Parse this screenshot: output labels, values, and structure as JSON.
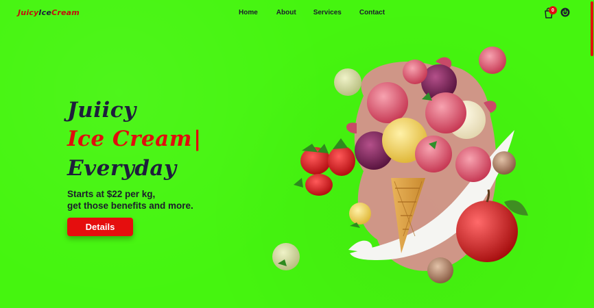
{
  "brand": {
    "part1": "Juicy",
    "part2": "Ice",
    "part3": "Cream"
  },
  "nav": {
    "items": [
      "Home",
      "About",
      "Services",
      "Contact"
    ]
  },
  "cart": {
    "count": "0",
    "icon": "shopping-bag-icon"
  },
  "power": {
    "icon": "power-icon"
  },
  "hero": {
    "line1": "Juiicy",
    "line2": "Ice Cream",
    "caret": "|",
    "line3": "Everyday",
    "sub1": "Starts at $22 per kg,",
    "sub2": "get those benefits and more.",
    "button": "Details"
  },
  "colors": {
    "background": "#45f50f",
    "accent": "#e00d0d",
    "dark": "#1e1e3c"
  }
}
